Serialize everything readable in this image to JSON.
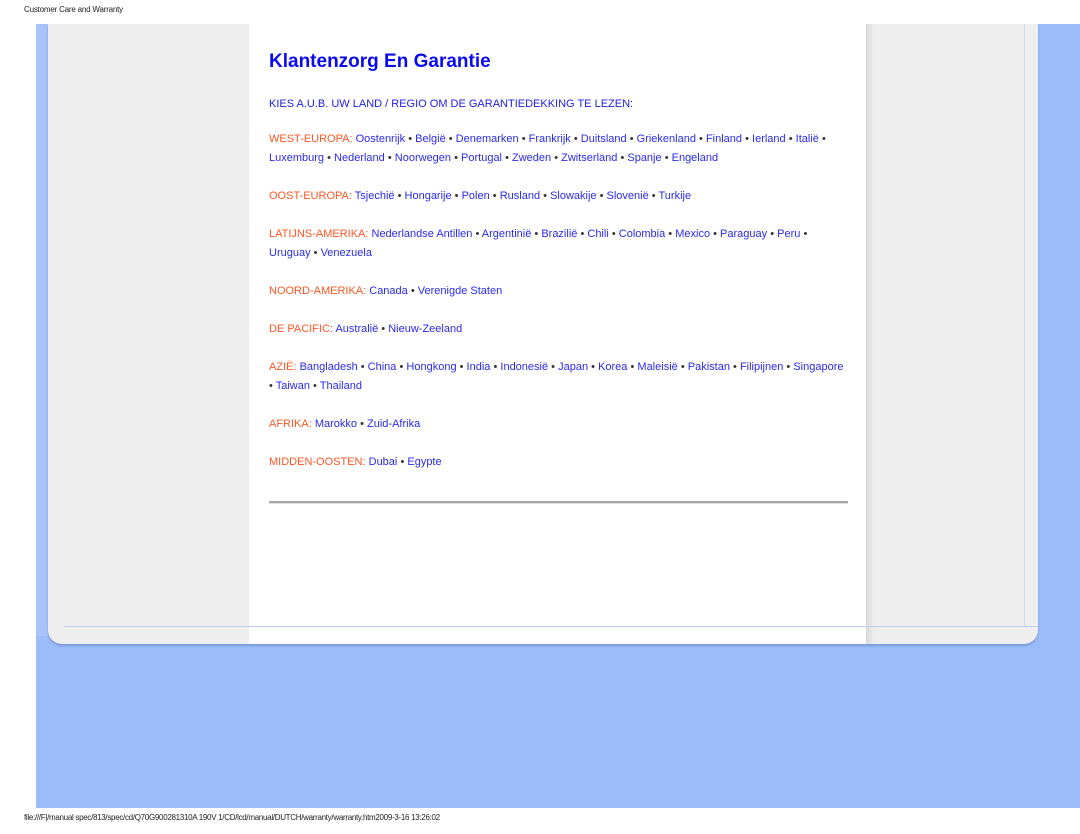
{
  "header_title": "Customer Care and Warranty",
  "footer_path": "file:///F|/manual spec/813/spec/cd/Q70G900281310A 190V 1/CD/lcd/manual/DUTCH/warranty/warranty.htm2009-3-16 13:26:02",
  "page": {
    "title": "Klantenzorg En Garantie",
    "intro": "KIES A.U.B. UW LAND / REGIO OM DE GARANTIEDEKKING TE LEZEN:",
    "separator": "•",
    "regions": [
      {
        "name": "WEST-EUROPA:",
        "countries": [
          "Oostenrijk",
          "België",
          "Denemarken",
          "Frankrijk",
          "Duitsland",
          "Griekenland",
          "Finland",
          "Ierland",
          "Italië",
          "Luxemburg",
          "Nederland",
          "Noorwegen",
          "Portugal",
          "Zweden",
          "Zwitserland",
          "Spanje",
          "Engeland"
        ]
      },
      {
        "name": "OOST-EUROPA:",
        "countries": [
          "Tsjechië",
          "Hongarije",
          "Polen",
          "Rusland",
          "Slowakije",
          "Slovenië",
          "Turkije"
        ]
      },
      {
        "name": "LATIJNS-AMERIKA:",
        "countries": [
          "Nederlandse Antillen",
          "Argentinië",
          "Brazilië",
          "Chili",
          "Colombia",
          "Mexico",
          "Paraguay",
          "Peru",
          "Uruguay",
          "Venezuela"
        ]
      },
      {
        "name": "NOORD-AMERIKA:",
        "countries": [
          "Canada",
          "Verenigde Staten"
        ]
      },
      {
        "name": "DE PACIFIC:",
        "countries": [
          "Australië",
          "Nieuw-Zeeland"
        ]
      },
      {
        "name": "AZIË:",
        "countries": [
          "Bangladesh",
          "China",
          "Hongkong",
          "India",
          "Indonesië",
          "Japan",
          "Korea",
          "Maleisië",
          "Pakistan",
          "Filipijnen",
          "Singapore",
          "Taiwan",
          "Thailand"
        ]
      },
      {
        "name": "AFRIKA:",
        "countries": [
          "Marokko",
          "Zuid-Afrika"
        ]
      },
      {
        "name": "MIDDEN-OOSTEN:",
        "countries": [
          "Dubai",
          "Egypte"
        ]
      }
    ]
  },
  "colors": {
    "link": "#2a2aee",
    "region_label": "#ff5722",
    "frame": "#9bbcf8",
    "panel": "#eeeeee"
  }
}
